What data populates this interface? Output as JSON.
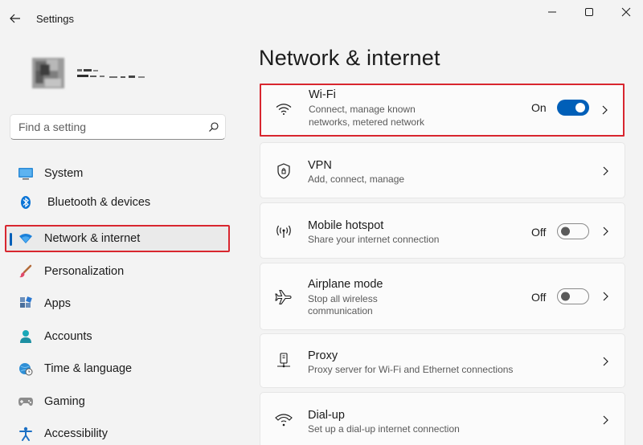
{
  "window": {
    "title": "Settings",
    "back_icon": "back-arrow-icon",
    "controls": [
      "minimize-icon",
      "maximize-icon",
      "close-icon"
    ]
  },
  "search": {
    "placeholder": "Find a setting",
    "value": ""
  },
  "sidebar": {
    "items": [
      {
        "label": "System",
        "icon": "monitor-icon"
      },
      {
        "label": "Bluetooth & devices",
        "icon": "bluetooth-icon"
      },
      {
        "label": "Network & internet",
        "icon": "wifi-diamond-icon",
        "selected": true
      },
      {
        "label": "Personalization",
        "icon": "brush-icon"
      },
      {
        "label": "Apps",
        "icon": "apps-icon"
      },
      {
        "label": "Accounts",
        "icon": "person-icon"
      },
      {
        "label": "Time & language",
        "icon": "globe-clock-icon"
      },
      {
        "label": "Gaming",
        "icon": "gamepad-icon"
      },
      {
        "label": "Accessibility",
        "icon": "accessibility-icon"
      }
    ]
  },
  "main": {
    "title": "Network & internet",
    "cards": [
      {
        "title": "Wi-Fi",
        "subtitle_lines": [
          "Connect, manage known",
          "networks, metered network"
        ],
        "state": "On",
        "toggle_on": true,
        "icon": "wifi-icon"
      },
      {
        "title": "VPN",
        "subtitle_lines": [
          "Add, connect, manage"
        ],
        "icon": "shield-icon"
      },
      {
        "title": "Mobile hotspot",
        "subtitle_lines": [
          "Share your internet connection"
        ],
        "state": "Off",
        "toggle_on": false,
        "icon": "hotspot-icon"
      },
      {
        "title": "Airplane mode",
        "subtitle_lines": [
          "Stop all wireless",
          "communication"
        ],
        "state": "Off",
        "toggle_on": false,
        "icon": "airplane-icon"
      },
      {
        "title": "Proxy",
        "subtitle_lines": [
          "Proxy server for Wi-Fi and Ethernet connections"
        ],
        "icon": "proxy-icon"
      },
      {
        "title": "Dial-up",
        "subtitle_lines": [
          "Set up a dial-up internet connection"
        ],
        "icon": "dialup-icon"
      }
    ]
  },
  "colors": {
    "accent": "#005fb8",
    "highlight_border": "#d8262f",
    "background": "#f3f3f3",
    "card": "#fbfbfb"
  }
}
